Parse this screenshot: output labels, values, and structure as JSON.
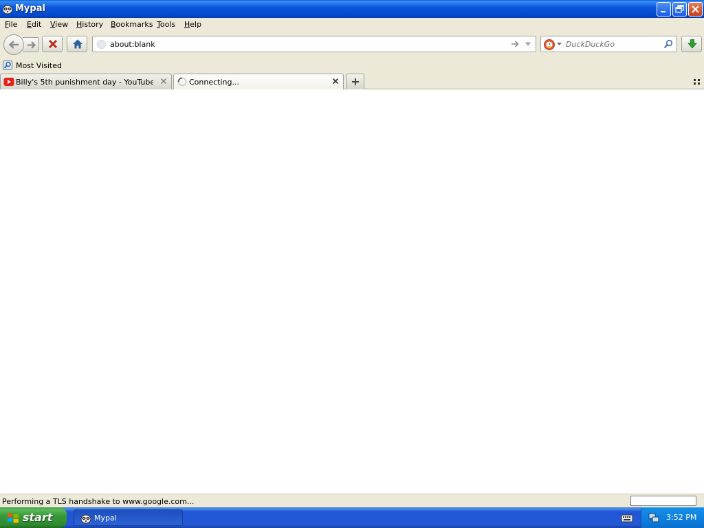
{
  "window": {
    "title": "Mypal",
    "app_icon": "mypal-raccoon-icon",
    "controls": [
      "minimize-icon",
      "restore-icon",
      "close-icon"
    ]
  },
  "menubar": {
    "items": [
      {
        "label": "File",
        "key": "F"
      },
      {
        "label": "Edit",
        "key": "E"
      },
      {
        "label": "View",
        "key": "V"
      },
      {
        "label": "History",
        "key": "H"
      },
      {
        "label": "Bookmarks",
        "key": "B"
      },
      {
        "label": "Tools",
        "key": "T"
      },
      {
        "label": "Help",
        "key": "H"
      }
    ]
  },
  "navbar": {
    "url": "about:blank",
    "search_placeholder": "DuckDuckGo",
    "search_engine_icon": "duckduckgo-icon",
    "buttons": [
      "back-icon",
      "forward-icon",
      "stop-icon",
      "home-icon",
      "download-icon"
    ]
  },
  "bookmarks": {
    "items": [
      {
        "label": "Most Visited",
        "icon": "most-visited-icon"
      }
    ]
  },
  "tabs": [
    {
      "label": "Billy's 5th punishment day - YouTube",
      "icon": "youtube-icon",
      "active": false
    },
    {
      "label": "Connecting...",
      "icon": "loading-spinner-icon",
      "active": true
    }
  ],
  "status": {
    "text": "Performing a TLS handshake to www.google.com..."
  },
  "taskbar": {
    "start_label": "start",
    "tasks": [
      {
        "label": "Mypal",
        "icon": "mypal-raccoon-icon"
      }
    ],
    "clock": "3:52 PM"
  },
  "colors": {
    "titlebar_blue": "#0a58dc",
    "chrome_beige": "#ece9d8",
    "start_green": "#379a37",
    "close_red": "#c6401c",
    "youtube_red": "#e62117",
    "download_green": "#2ea02e"
  }
}
